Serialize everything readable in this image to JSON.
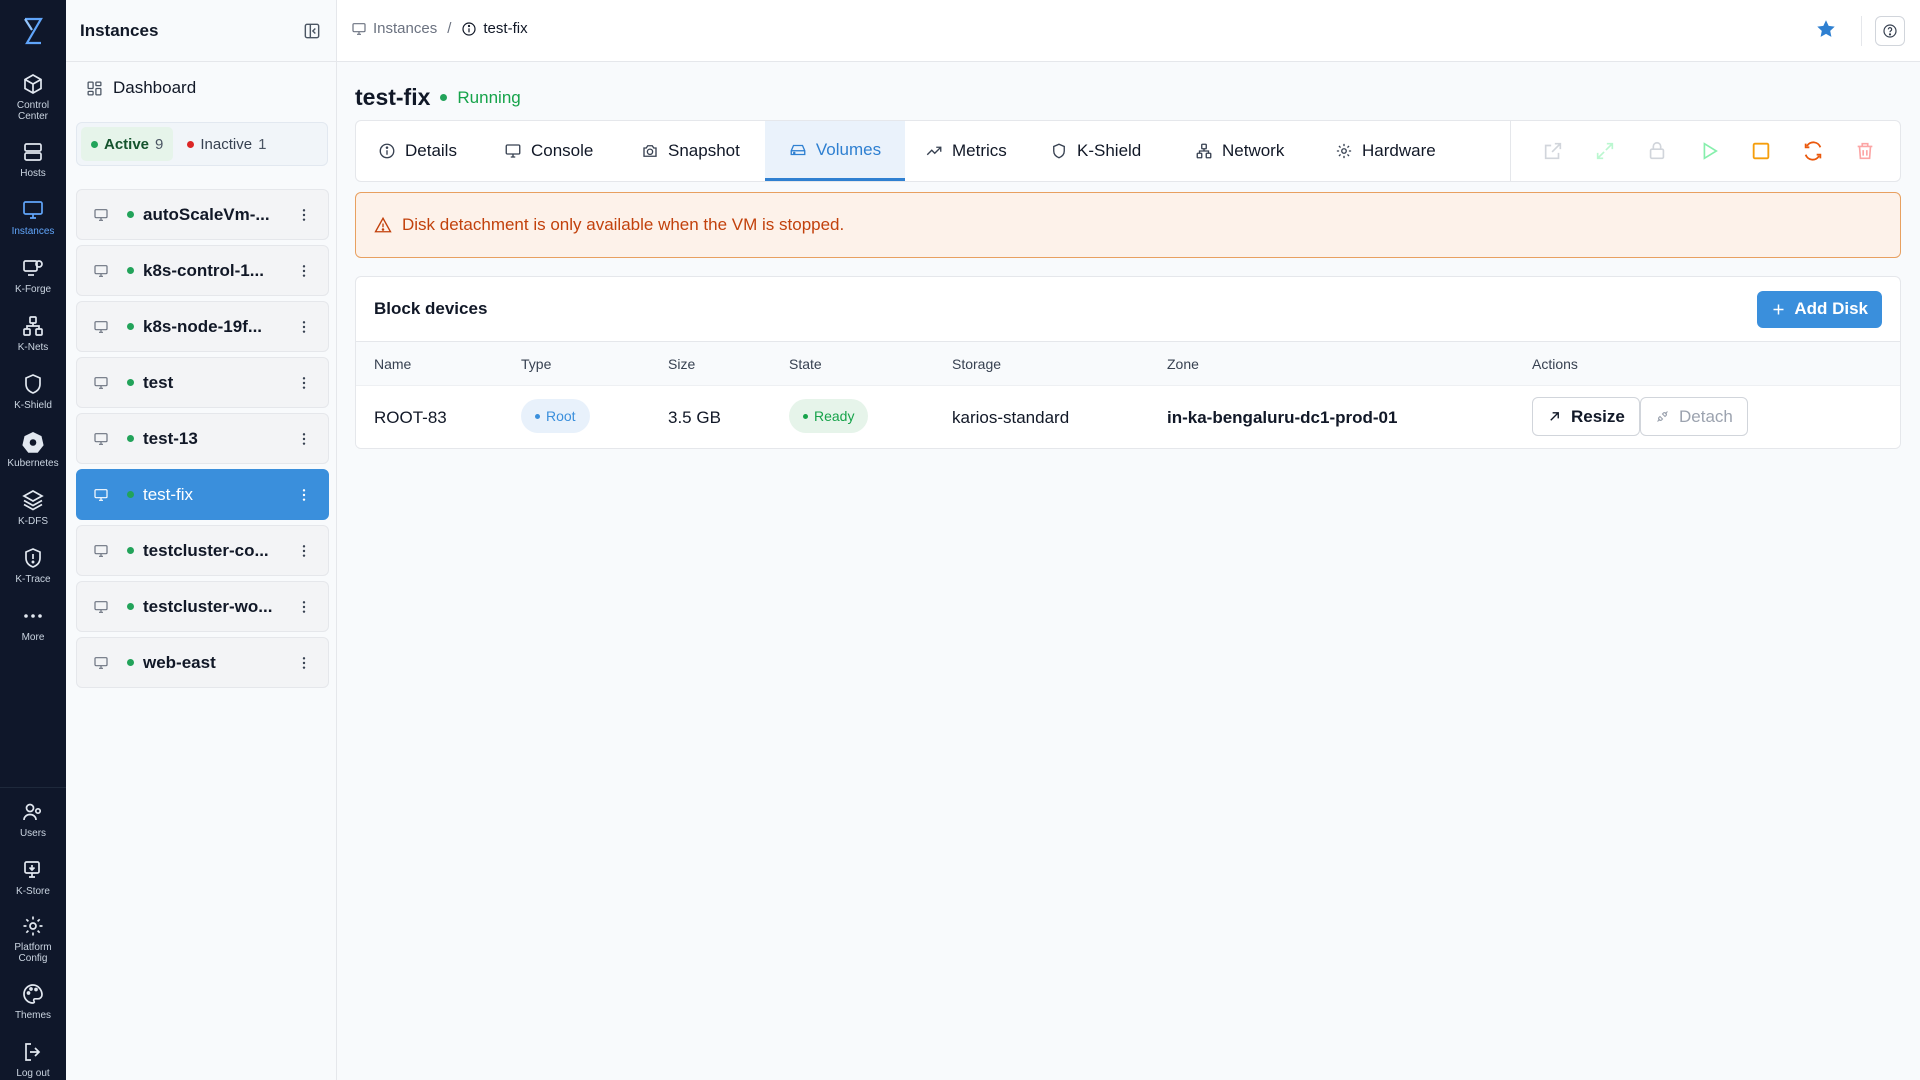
{
  "rail": {
    "items": [
      {
        "label": "Control Center",
        "icon": "cube-icon"
      },
      {
        "label": "Hosts",
        "icon": "server-icon"
      },
      {
        "label": "Instances",
        "icon": "monitor-icon"
      },
      {
        "label": "K-Forge",
        "icon": "forge-icon"
      },
      {
        "label": "K-Nets",
        "icon": "network-icon"
      },
      {
        "label": "K-Shield",
        "icon": "shield-icon"
      },
      {
        "label": "Kubernetes",
        "icon": "kubernetes-icon"
      },
      {
        "label": "K-DFS",
        "icon": "layers-icon"
      },
      {
        "label": "K-Trace",
        "icon": "trace-shield-icon"
      },
      {
        "label": "More",
        "icon": "more-dots-icon"
      }
    ],
    "bottom": [
      {
        "label": "Users",
        "icon": "users-icon"
      },
      {
        "label": "K-Store",
        "icon": "store-icon"
      },
      {
        "label": "Platform Config",
        "icon": "gear-icon"
      },
      {
        "label": "Themes",
        "icon": "palette-icon"
      },
      {
        "label": "Log out",
        "icon": "logout-icon"
      }
    ],
    "active_color": "#60a5fa"
  },
  "sidebar": {
    "title": "Instances",
    "dashboard_label": "Dashboard",
    "filters": {
      "active_label": "Active",
      "active_count": "9",
      "inactive_label": "Inactive",
      "inactive_count": "1"
    },
    "instances": [
      {
        "name": "autoScaleVm-..."
      },
      {
        "name": "k8s-control-1..."
      },
      {
        "name": "k8s-node-19f..."
      },
      {
        "name": "test"
      },
      {
        "name": "test-13"
      },
      {
        "name": "test-fix"
      },
      {
        "name": "testcluster-co..."
      },
      {
        "name": "testcluster-wo..."
      },
      {
        "name": "web-east"
      }
    ],
    "selected": "test-fix"
  },
  "breadcrumb": {
    "root": "Instances",
    "separator": "/",
    "current": "test-fix"
  },
  "vm": {
    "name": "test-fix",
    "status": "Running"
  },
  "tabs": [
    {
      "label": "Details",
      "icon": "info-icon"
    },
    {
      "label": "Console",
      "icon": "monitor-icon"
    },
    {
      "label": "Snapshot",
      "icon": "camera-icon"
    },
    {
      "label": "Volumes",
      "icon": "drive-icon"
    },
    {
      "label": "Metrics",
      "icon": "trend-icon"
    },
    {
      "label": "K-Shield",
      "icon": "shield-icon"
    },
    {
      "label": "Network",
      "icon": "network-icon"
    },
    {
      "label": "Hardware",
      "icon": "gear-icon"
    }
  ],
  "active_tab": "Volumes",
  "warning": {
    "text": "Disk detachment is only available when the VM is stopped."
  },
  "block_devices": {
    "title": "Block devices",
    "add_label": "Add Disk",
    "columns": [
      "Name",
      "Type",
      "Size",
      "State",
      "Storage",
      "Zone",
      "Actions"
    ],
    "rows": [
      {
        "name": "ROOT-83",
        "type": "Root",
        "size": "3.5 GB",
        "state": "Ready",
        "storage": "karios-standard",
        "zone": "in-ka-bengaluru-dc1-prod-01",
        "resize_label": "Resize",
        "detach_label": "Detach"
      }
    ]
  },
  "colors": {
    "accent": "#3a8fdc",
    "running": "#16a34a",
    "warning": "#c2410c",
    "stop_action": "#f59e0b",
    "restart_action": "#ea580c",
    "delete_action": "#f87171"
  }
}
